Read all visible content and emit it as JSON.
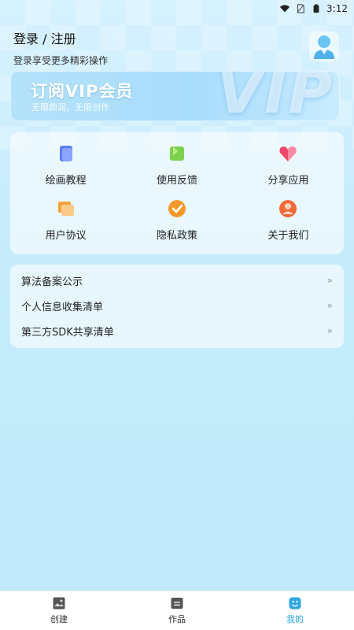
{
  "statusbar": {
    "time": "3:12",
    "icons": [
      "wifi-icon",
      "no-sim-icon",
      "battery-icon"
    ]
  },
  "header": {
    "login_title": "登录 / 注册",
    "login_subtitle": "登录享受更多精彩操作",
    "avatar_icon": "user-avatar-icon"
  },
  "vip": {
    "title": "订阅VIP会员",
    "subtitle": "无限颜润，无限创作",
    "watermark": "VIP"
  },
  "grid": [
    {
      "label": "绘画教程",
      "icon": "tutorial-icon",
      "color": "#5b7cf7"
    },
    {
      "label": "使用反馈",
      "icon": "feedback-icon",
      "color": "#7bd24e"
    },
    {
      "label": "分享应用",
      "icon": "share-heart-icon",
      "color": "#f0476a"
    },
    {
      "label": "用户协议",
      "icon": "agreement-icon",
      "color": "#f5a040"
    },
    {
      "label": "隐私政策",
      "icon": "privacy-icon",
      "color": "#f59a2a"
    },
    {
      "label": "关于我们",
      "icon": "about-icon",
      "color": "#f26a3a"
    }
  ],
  "list": [
    {
      "label": "算法备案公示",
      "chevron": "»"
    },
    {
      "label": "个人信息收集清单",
      "chevron": "»"
    },
    {
      "label": "第三方SDK共享清单",
      "chevron": "»"
    }
  ],
  "tabs": [
    {
      "label": "创建",
      "icon": "image-icon",
      "active": false
    },
    {
      "label": "作品",
      "icon": "folder-icon",
      "active": false
    },
    {
      "label": "我的",
      "icon": "smile-icon",
      "active": true
    }
  ],
  "colors": {
    "accent": "#2fa7e6",
    "background": "#c6ecfb"
  }
}
